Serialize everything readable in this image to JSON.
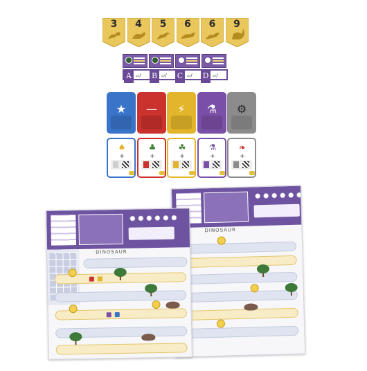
{
  "banners": {
    "numbers": [
      "3",
      "4",
      "5",
      "6",
      "6",
      "9"
    ],
    "color": "#e9c75c",
    "icon": "dinosaur-icon"
  },
  "objectives": {
    "letters": [
      "A",
      "B",
      "C",
      "D"
    ],
    "color": "#6a4a96"
  },
  "cards": [
    {
      "color": "#3a74c9",
      "icon": "meeple-icon",
      "glyph": "★"
    },
    {
      "color": "#c9322d",
      "icon": "minus-icon",
      "glyph": "—"
    },
    {
      "color": "#e3b52a",
      "icon": "lightning-icon",
      "glyph": "⚡"
    },
    {
      "color": "#7a4fa7",
      "icon": "flask-icon",
      "glyph": "⚗"
    },
    {
      "color": "#8c8c8c",
      "icon": "gear-icon",
      "glyph": "⚙"
    }
  ],
  "scoring_cards": [
    {
      "border": "#3a74c9",
      "icon": "trophy-icon",
      "glyph": "♠",
      "color": "#e2b21e",
      "plus": "+"
    },
    {
      "border": "#c9322d",
      "icon": "paw-icon",
      "glyph": "♣",
      "color": "#3b7d2f",
      "plus": "+"
    },
    {
      "border": "#e3b52a",
      "icon": "fern-icon",
      "glyph": "☘",
      "color": "#3b7d2f",
      "plus": "+"
    },
    {
      "border": "#7a4fa7",
      "icon": "flask-icon",
      "glyph": "⚗",
      "color": "#6a4a96",
      "plus": "+"
    },
    {
      "border": "#8c8c8c",
      "icon": "feather-icon",
      "glyph": "❧",
      "color": "#c9322d",
      "plus": "+"
    }
  ],
  "boards": [
    {
      "title": "DINOSAUR"
    },
    {
      "title": "DINOSAUR"
    }
  ]
}
